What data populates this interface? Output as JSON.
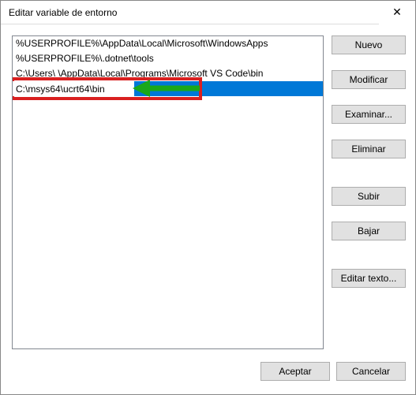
{
  "window": {
    "title": "Editar variable de entorno",
    "close_label": "✕"
  },
  "list": {
    "items": [
      "%USERPROFILE%\\AppData\\Local\\Microsoft\\WindowsApps",
      "%USERPROFILE%\\.dotnet\\tools",
      "C:\\Users\\            \\AppData\\Local\\Programs\\Microsoft VS Code\\bin",
      "C:\\msys64\\ucrt64\\bin"
    ],
    "selected_index": 3,
    "editing_index": 3,
    "edit_value": "C:\\msys64\\ucrt64\\bin"
  },
  "buttons": {
    "new": "Nuevo",
    "edit": "Modificar",
    "browse": "Examinar...",
    "delete": "Eliminar",
    "up": "Subir",
    "down": "Bajar",
    "edit_text": "Editar texto...",
    "ok": "Aceptar",
    "cancel": "Cancelar"
  },
  "annotation": {
    "color_box": "#d92020",
    "color_arrow": "#1aa81a"
  }
}
